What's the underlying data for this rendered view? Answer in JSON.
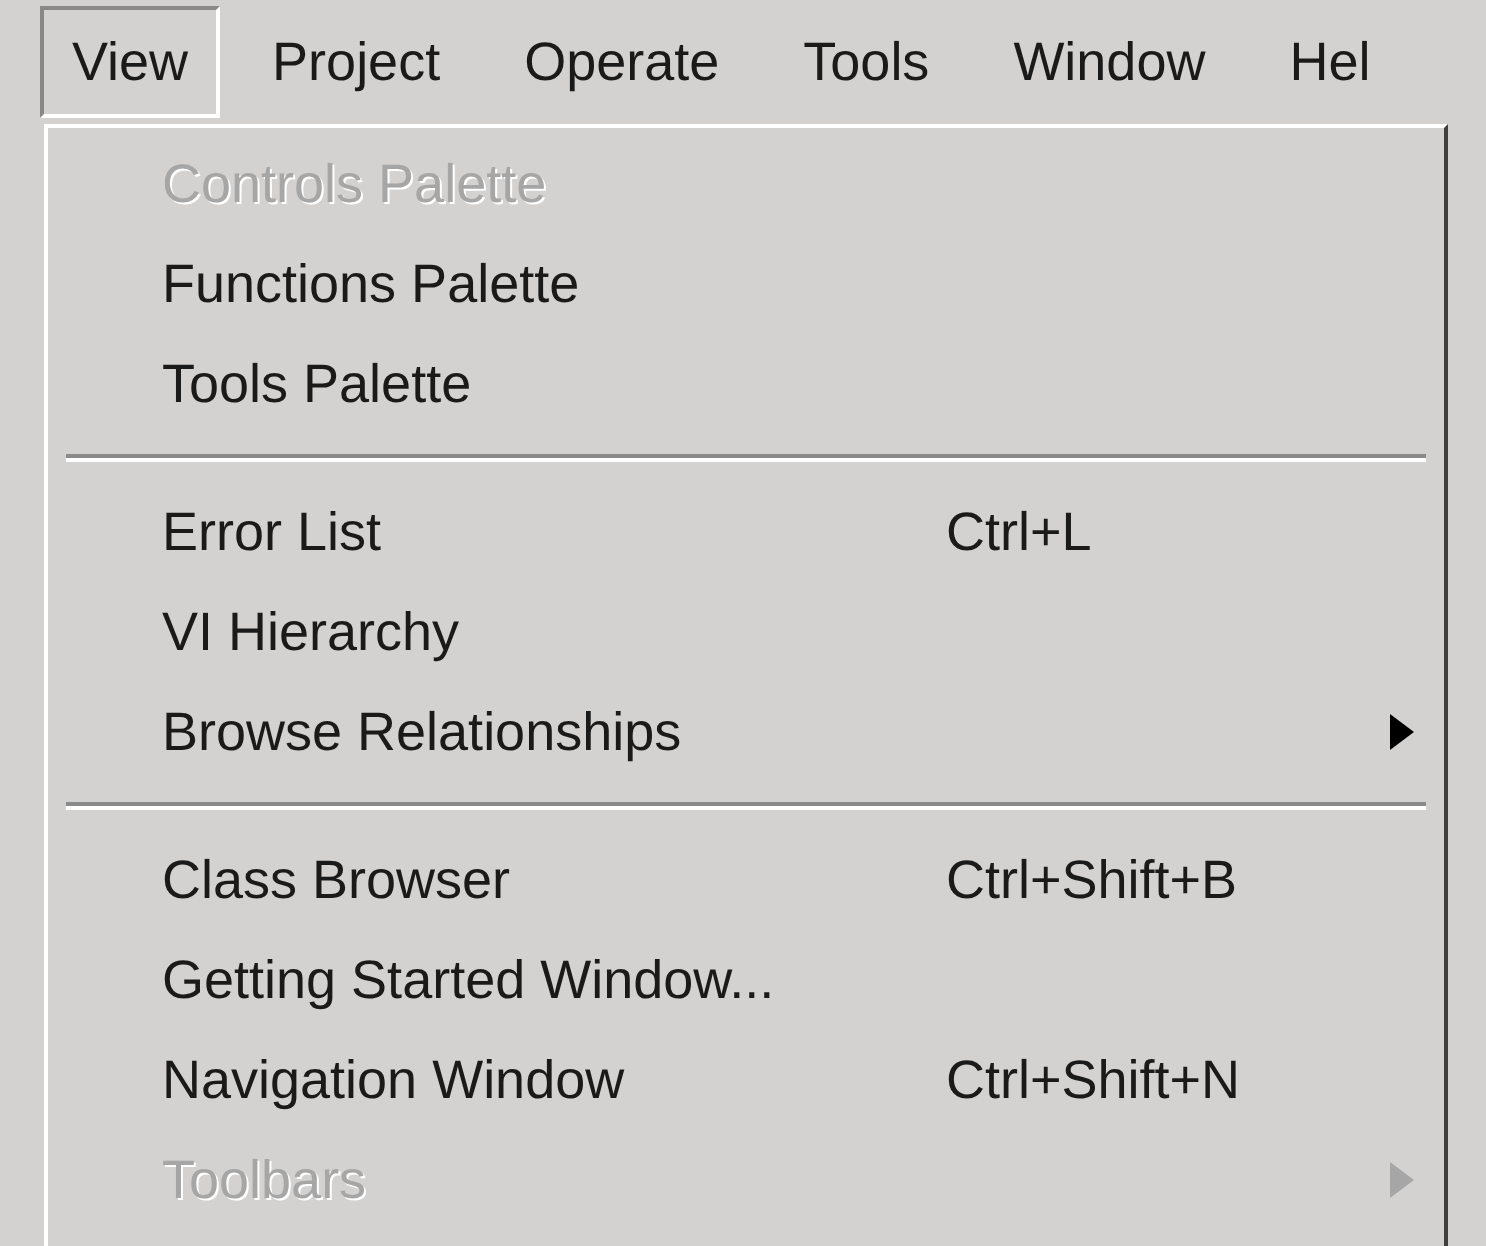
{
  "menu_bar": [
    {
      "label": "View",
      "selected": true
    },
    {
      "label": "Project",
      "selected": false
    },
    {
      "label": "Operate",
      "selected": false
    },
    {
      "label": "Tools",
      "selected": false
    },
    {
      "label": "Window",
      "selected": false
    },
    {
      "label": "Hel",
      "selected": false
    }
  ],
  "menu": {
    "items": [
      {
        "kind": "item",
        "label": "Controls Palette",
        "disabled": true
      },
      {
        "kind": "item",
        "label": "Functions Palette",
        "disabled": false
      },
      {
        "kind": "item",
        "label": "Tools Palette",
        "disabled": false
      },
      {
        "kind": "separator"
      },
      {
        "kind": "item",
        "label": "Error List",
        "disabled": false,
        "shortcut": "Ctrl+L"
      },
      {
        "kind": "item",
        "label": "VI Hierarchy",
        "disabled": false
      },
      {
        "kind": "item",
        "label": "Browse Relationships",
        "disabled": false,
        "submenu": true
      },
      {
        "kind": "separator"
      },
      {
        "kind": "item",
        "label": "Class Browser",
        "disabled": false,
        "shortcut": "Ctrl+Shift+B"
      },
      {
        "kind": "item",
        "label": "Getting Started Window...",
        "disabled": false
      },
      {
        "kind": "item",
        "label": "Navigation Window",
        "disabled": false,
        "shortcut": "Ctrl+Shift+N"
      },
      {
        "kind": "item",
        "label": "Toolbars",
        "disabled": true,
        "submenu": true
      }
    ]
  }
}
